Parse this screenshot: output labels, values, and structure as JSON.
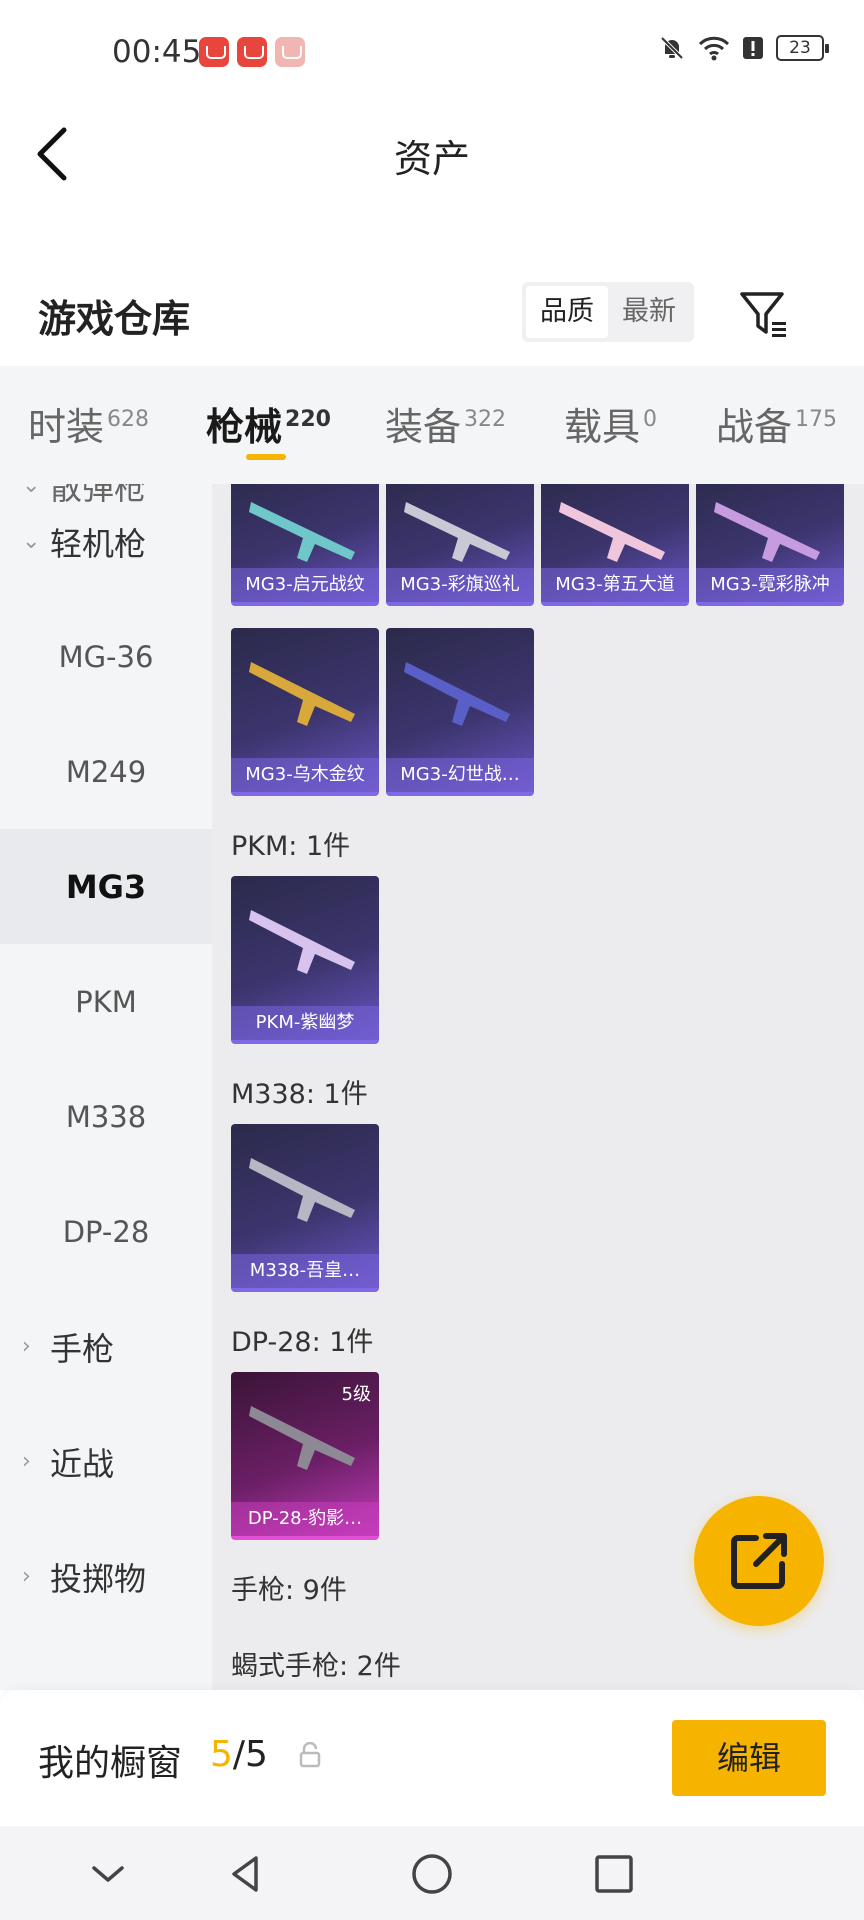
{
  "status": {
    "time": "00:45",
    "battery": "23"
  },
  "nav": {
    "title": "资产"
  },
  "section": {
    "title": "游戏仓库",
    "sort_options": [
      "品质",
      "最新"
    ],
    "active_sort": "品质"
  },
  "tabs": [
    {
      "label": "时装",
      "count": "628"
    },
    {
      "label": "枪械",
      "count": "220"
    },
    {
      "label": "装备",
      "count": "322"
    },
    {
      "label": "载具",
      "count": "0"
    },
    {
      "label": "战备",
      "count": "175"
    }
  ],
  "sidebar": {
    "partial_top": "散弹枪",
    "lmg_category": "轻机枪",
    "items": [
      "MG-36",
      "M249",
      "MG3",
      "PKM",
      "M338",
      "DP-28"
    ],
    "active_item": "MG3",
    "more_categories": [
      "手枪",
      "近战",
      "投掷物"
    ]
  },
  "content": {
    "mg3_row1": [
      "MG3-启元战纹",
      "MG3-彩旗巡礼",
      "MG3-第五大道",
      "MG3-霓彩脉冲"
    ],
    "mg3_row2": [
      "MG3-乌木金纹",
      "MG3-幻世战…"
    ],
    "pkm_label": "PKM: 1件",
    "pkm_items": [
      "PKM-紫幽梦"
    ],
    "m338_label": "M338: 1件",
    "m338_items": [
      "M338-吾皇…"
    ],
    "dp28_label": "DP-28: 1件",
    "dp28_items": [
      "DP-28-豹影…"
    ],
    "dp28_level": "5级",
    "pistol_label": "手枪: 9件",
    "scorpion_label": "蝎式手枪: 2件"
  },
  "showcase": {
    "title": "我的橱窗",
    "current": "5",
    "separator": "/",
    "max": "5",
    "edit_label": "编辑"
  },
  "colors": {
    "accent": "#f6b400",
    "card_purple": "#6a55c4",
    "card_pink": "#c23dba"
  }
}
